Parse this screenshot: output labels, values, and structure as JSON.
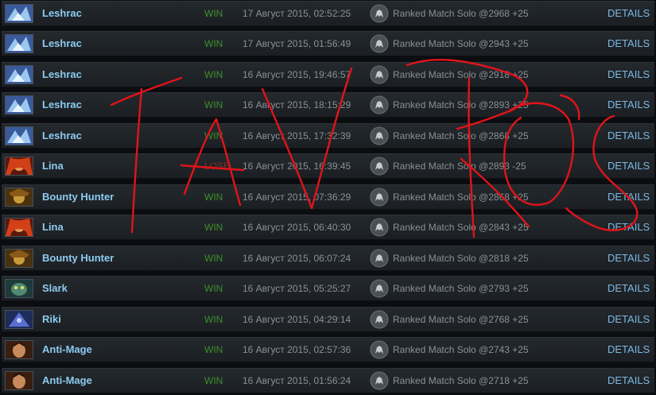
{
  "details_label": "DETAILS",
  "colors": {
    "win": "#3e8f2a",
    "lose": "#8a2a22",
    "hero_name": "#8ccbef",
    "details": "#7cb8e2",
    "scribble": "#e0141a"
  },
  "matches": [
    {
      "hero": "Leshrac",
      "hero_icon": "leshrac-portrait-icon",
      "result": "WIN",
      "date": "17 Август 2015, 02:52:25",
      "mode": "Ranked Match Solo @2968 +25"
    },
    {
      "hero": "Leshrac",
      "hero_icon": "leshrac-portrait-icon",
      "result": "WIN",
      "date": "17 Август 2015, 01:56:49",
      "mode": "Ranked Match Solo @2943 +25"
    },
    {
      "hero": "Leshrac",
      "hero_icon": "leshrac-portrait-icon",
      "result": "WIN",
      "date": "16 Август 2015, 19:46:57",
      "mode": "Ranked Match Solo @2918 +25"
    },
    {
      "hero": "Leshrac",
      "hero_icon": "leshrac-portrait-icon",
      "result": "WIN",
      "date": "16 Август 2015, 18:15:29",
      "mode": "Ranked Match Solo @2893 +25"
    },
    {
      "hero": "Leshrac",
      "hero_icon": "leshrac-portrait-icon",
      "result": "WIN",
      "date": "16 Август 2015, 17:32:39",
      "mode": "Ranked Match Solo @2868 +25"
    },
    {
      "hero": "Lina",
      "hero_icon": "lina-portrait-icon",
      "result": "LOSE",
      "date": "16 Август 2015, 16:39:45",
      "mode": "Ranked Match Solo @2893 -25"
    },
    {
      "hero": "Bounty Hunter",
      "hero_icon": "bounty-hunter-portrait-icon",
      "result": "WIN",
      "date": "16 Август 2015, 07:36:29",
      "mode": "Ranked Match Solo @2868 +25"
    },
    {
      "hero": "Lina",
      "hero_icon": "lina-portrait-icon",
      "result": "WIN",
      "date": "16 Август 2015, 06:40:30",
      "mode": "Ranked Match Solo @2843 +25"
    },
    {
      "hero": "Bounty Hunter",
      "hero_icon": "bounty-hunter-portrait-icon",
      "result": "WIN",
      "date": "16 Август 2015, 06:07:24",
      "mode": "Ranked Match Solo @2818 +25"
    },
    {
      "hero": "Slark",
      "hero_icon": "slark-portrait-icon",
      "result": "WIN",
      "date": "16 Август 2015, 05:25:27",
      "mode": "Ranked Match Solo @2793 +25"
    },
    {
      "hero": "Riki",
      "hero_icon": "riki-portrait-icon",
      "result": "WIN",
      "date": "16 Август 2015, 04:29:14",
      "mode": "Ranked Match Solo @2768 +25"
    },
    {
      "hero": "Anti-Mage",
      "hero_icon": "anti-mage-portrait-icon",
      "result": "WIN",
      "date": "16 Август 2015, 02:57:36",
      "mode": "Ranked Match Solo @2743 +25"
    },
    {
      "hero": "Anti-Mage",
      "hero_icon": "anti-mage-portrait-icon",
      "result": "WIN",
      "date": "16 Август 2015, 01:56:24",
      "mode": "Ranked Match Solo @2718 +25"
    }
  ]
}
